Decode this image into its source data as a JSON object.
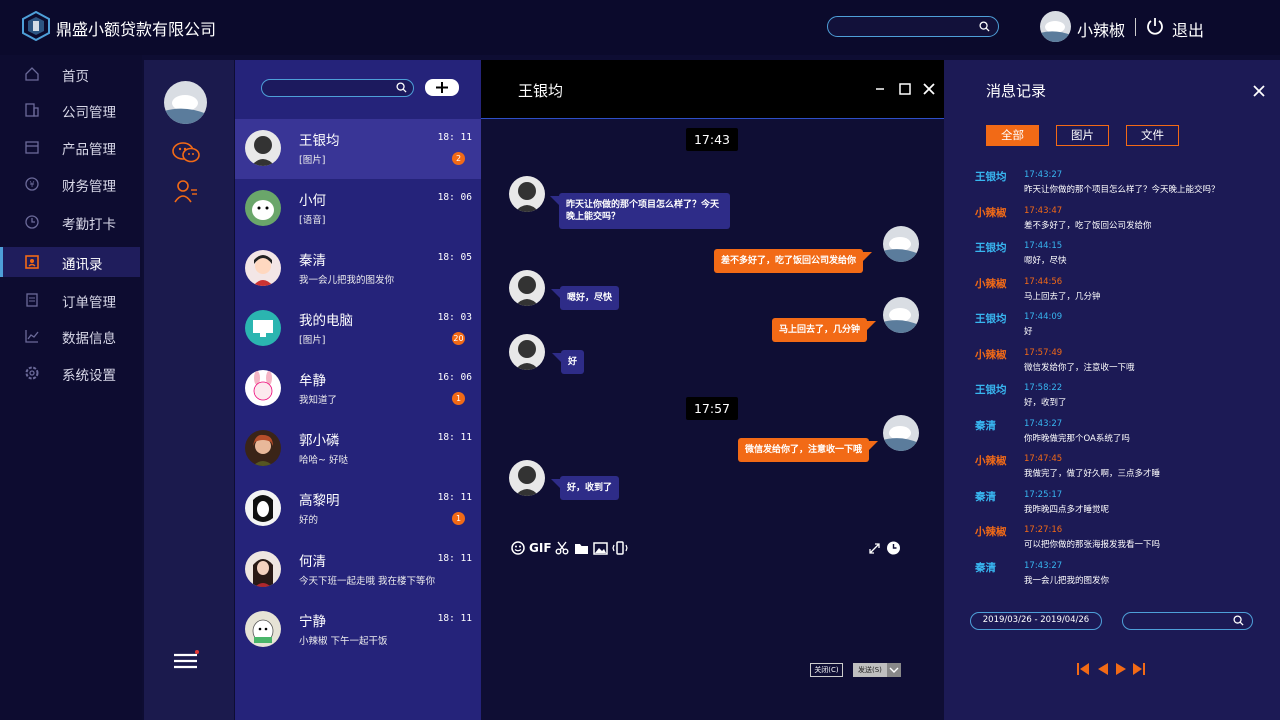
{
  "app": {
    "title": "鼎盛小额贷款有限公司"
  },
  "header": {
    "user_name": "小辣椒",
    "logout_label": "退出",
    "search_placeholder": ""
  },
  "sidebar": {
    "items": [
      {
        "label": "首页",
        "icon": "home-icon"
      },
      {
        "label": "公司管理",
        "icon": "building-icon"
      },
      {
        "label": "产品管理",
        "icon": "product-icon"
      },
      {
        "label": "财务管理",
        "icon": "finance-icon"
      },
      {
        "label": "考勤打卡",
        "icon": "clock-icon"
      },
      {
        "label": "通讯录",
        "icon": "address-book-icon",
        "active": true
      },
      {
        "label": "订单管理",
        "icon": "order-icon"
      },
      {
        "label": "数据信息",
        "icon": "chart-icon"
      },
      {
        "label": "系统设置",
        "icon": "gear-icon"
      }
    ]
  },
  "contacts": [
    {
      "name": "王银均",
      "time": "18: 11",
      "msg": "[图片]",
      "badge": "2"
    },
    {
      "name": "小何",
      "time": "18: 06",
      "msg": "[语音]",
      "badge": ""
    },
    {
      "name": "秦清",
      "time": "18: 05",
      "msg": "我一会儿把我的图发你",
      "badge": ""
    },
    {
      "name": "我的电脑",
      "time": "18: 03",
      "msg": "[图片]",
      "badge": "20"
    },
    {
      "name": "牟静",
      "time": "16: 06",
      "msg": "我知道了",
      "badge": "1"
    },
    {
      "name": "郭小磷",
      "time": "18: 11",
      "msg": "哈哈~ 好哒",
      "badge": ""
    },
    {
      "name": "高黎明",
      "time": "18: 11",
      "msg": "好的",
      "badge": "1"
    },
    {
      "name": "何清",
      "time": "18: 11",
      "msg": "今天下班一起走哦 我在楼下等你",
      "badge": ""
    },
    {
      "name": "宁静",
      "time": "18: 11",
      "msg": "小辣椒 下午一起干饭",
      "badge": ""
    }
  ],
  "chat": {
    "title": "王银均",
    "time1": "17:43",
    "time2": "17:57",
    "messages": [
      "昨天让你做的那个项目怎么样了？今天晚上能交吗？",
      "差不多好了，吃了饭回公司发给你",
      "嗯好，尽快",
      "马上回去了，几分钟",
      "好",
      "微信发给你了，注意收一下哦",
      "好，收到了"
    ],
    "gif_label": "GIF",
    "close_label": "关闭(C)",
    "send_label": "发送(S)"
  },
  "history": {
    "title": "消息记录",
    "filters": [
      "全部",
      "图片",
      "文件"
    ],
    "records": [
      {
        "name": "王银均",
        "time": "17:43:27",
        "text": "昨天让你做的那个项目怎么样了？今天晚上能交吗？",
        "side": "blue"
      },
      {
        "name": "小辣椒",
        "time": "17:43:47",
        "text": "差不多好了，吃了饭回公司发给你",
        "side": "orange"
      },
      {
        "name": "王银均",
        "time": "17:44:15",
        "text": "嗯好，尽快",
        "side": "blue"
      },
      {
        "name": "小辣椒",
        "time": "17:44:56",
        "text": "马上回去了，几分钟",
        "side": "orange"
      },
      {
        "name": "王银均",
        "time": "17:44:09",
        "text": "好",
        "side": "blue"
      },
      {
        "name": "小辣椒",
        "time": "17:57:49",
        "text": "微信发给你了，注意收一下哦",
        "side": "orange"
      },
      {
        "name": "王银均",
        "time": "17:58:22",
        "text": "好，收到了",
        "side": "blue"
      },
      {
        "name": "秦清",
        "time": "17:43:27",
        "text": "你昨晚做完那个OA系统了吗",
        "side": "blue"
      },
      {
        "name": "小辣椒",
        "time": "17:47:45",
        "text": "我做完了，做了好久啊，三点多才睡",
        "side": "orange"
      },
      {
        "name": "秦清",
        "time": "17:25:17",
        "text": "我昨晚四点多才睡觉呢",
        "side": "blue"
      },
      {
        "name": "小辣椒",
        "time": "17:27:16",
        "text": "可以把你做的那张海报发我看一下吗",
        "side": "orange"
      },
      {
        "name": "秦清",
        "time": "17:43:27",
        "text": "我一会儿把我的图发你",
        "side": "blue"
      }
    ],
    "date_range": "2019/03/26 - 2019/04/26"
  },
  "colors": {
    "accent": "#f26a16",
    "highlight": "#4e9fd8",
    "bg": "#0e0d33"
  }
}
